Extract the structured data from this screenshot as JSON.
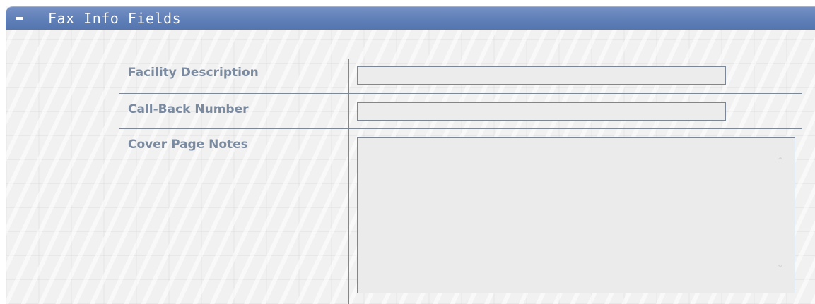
{
  "panel": {
    "title": "Fax Info Fields",
    "collapse_icon": "minus-icon"
  },
  "fields": {
    "facility_description": {
      "label": "Facility Description",
      "value": ""
    },
    "call_back_number": {
      "label": "Call-Back Number",
      "value": ""
    },
    "cover_page_notes": {
      "label": "Cover Page Notes",
      "value": ""
    }
  },
  "scroll": {
    "up_glyph": "⌃",
    "down_glyph": "⌄"
  },
  "colors": {
    "header": "#5f7fb8",
    "label": "#7a8aa0",
    "border": "#7b8796"
  }
}
